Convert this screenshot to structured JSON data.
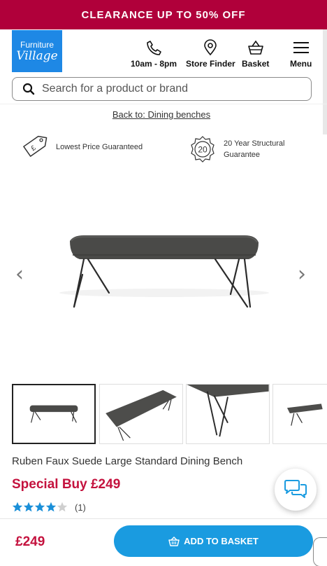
{
  "promo": {
    "text": "CLEARANCE UP TO 50% OFF"
  },
  "header": {
    "logo": {
      "line1": "Furniture",
      "line2": "Village"
    },
    "phone": {
      "label": "10am - 8pm",
      "icon": "phone-icon"
    },
    "store_finder": {
      "label": "Store Finder",
      "icon": "map-pin-icon"
    },
    "basket": {
      "label": "Basket",
      "icon": "basket-icon"
    },
    "menu": {
      "label": "Menu",
      "icon": "hamburger-icon"
    }
  },
  "search": {
    "placeholder": "Search for a product or brand",
    "value": ""
  },
  "breadcrumb": {
    "back_link": "Back to: Dining benches"
  },
  "badges": [
    {
      "text": "Lowest Price Guaranteed",
      "icon": "price-tag-icon",
      "symbol": "£"
    },
    {
      "text_line1": "20 Year Structural",
      "text_line2": "Guarantee",
      "icon": "guarantee-seal-icon",
      "number": "20"
    }
  ],
  "gallery": {
    "prev_label": "‹",
    "next_label": "›",
    "thumbnail_count": 4,
    "selected_index": 0
  },
  "product": {
    "title": "Ruben Faux Suede Large Standard Dining Bench",
    "special_price": "Special Buy £249",
    "rating": 4,
    "rating_max": 5,
    "review_count": "(1)"
  },
  "bottom_bar": {
    "price": "£249",
    "add_to_basket": "ADD TO BASKET"
  },
  "colors": {
    "promo_bg": "#b0003a",
    "brand_blue": "#1e88e5",
    "price_red": "#c4123e",
    "cta_blue": "#1a9be0",
    "star_blue": "#1a8fd8"
  }
}
